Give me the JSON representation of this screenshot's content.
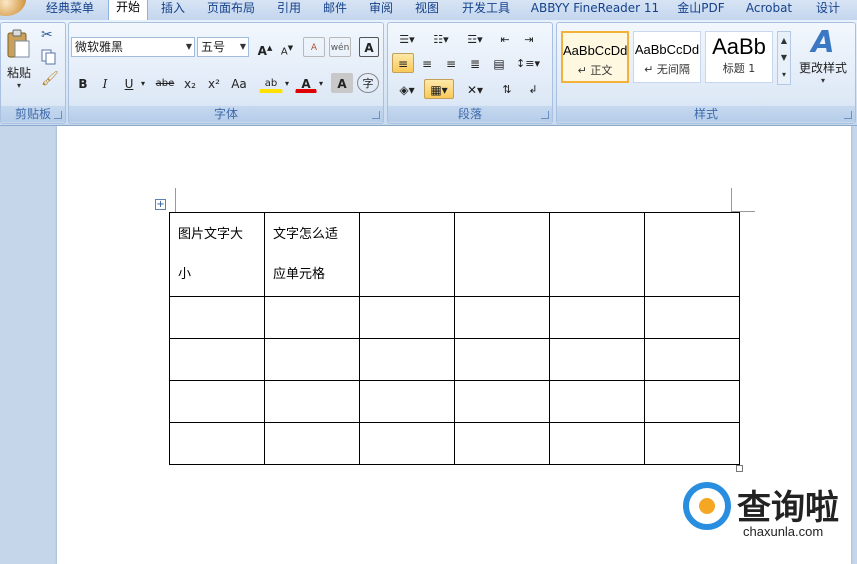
{
  "tabs": [
    "经典菜单",
    "开始",
    "插入",
    "页面布局",
    "引用",
    "邮件",
    "审阅",
    "视图",
    "开发工具",
    "ABBYY FineReader 11",
    "金山PDF",
    "Acrobat",
    "设计"
  ],
  "active_tab": "开始",
  "clipboard": {
    "paste_label": "粘贴",
    "group_label": "剪贴板"
  },
  "font": {
    "font_name": "微软雅黑",
    "font_size": "五号",
    "group_label": "字体",
    "buttons": {
      "bold": "B",
      "italic": "I",
      "underline": "U",
      "strike": "abe",
      "subscript": "x₂",
      "superscript": "x²",
      "change_case": "Aa",
      "grow": "A",
      "shrink": "A",
      "clear": "A",
      "highlight": "ab",
      "font_color": "A",
      "char_shade": "A",
      "enclose": "字",
      "phonetic": "wén",
      "border": "A"
    }
  },
  "paragraph": {
    "group_label": "段落"
  },
  "styles": {
    "group_label": "样式",
    "items": [
      {
        "sample": "AaBbCcDd",
        "name": "正文",
        "marker": "↵"
      },
      {
        "sample": "AaBbCcDd",
        "name": "无间隔",
        "marker": "↵"
      },
      {
        "sample": "AaBb",
        "name": "标题 1",
        "marker": ""
      }
    ],
    "change_styles_label": "更改样式"
  },
  "table": {
    "rows": [
      [
        "图片文字大\n\n小",
        "文字怎么适\n\n应单元格",
        "",
        "",
        "",
        ""
      ],
      [
        "",
        "",
        "",
        "",
        "",
        ""
      ],
      [
        "",
        "",
        "",
        "",
        "",
        ""
      ],
      [
        "",
        "",
        "",
        "",
        "",
        ""
      ],
      [
        "",
        "",
        "",
        "",
        "",
        ""
      ]
    ]
  },
  "watermark": {
    "brand": "查询啦",
    "site": "chaxunla.com"
  },
  "colors": {
    "accent": "#2a8ee0",
    "ribbon": "#dde8f6",
    "selected": "#f9c95a"
  }
}
